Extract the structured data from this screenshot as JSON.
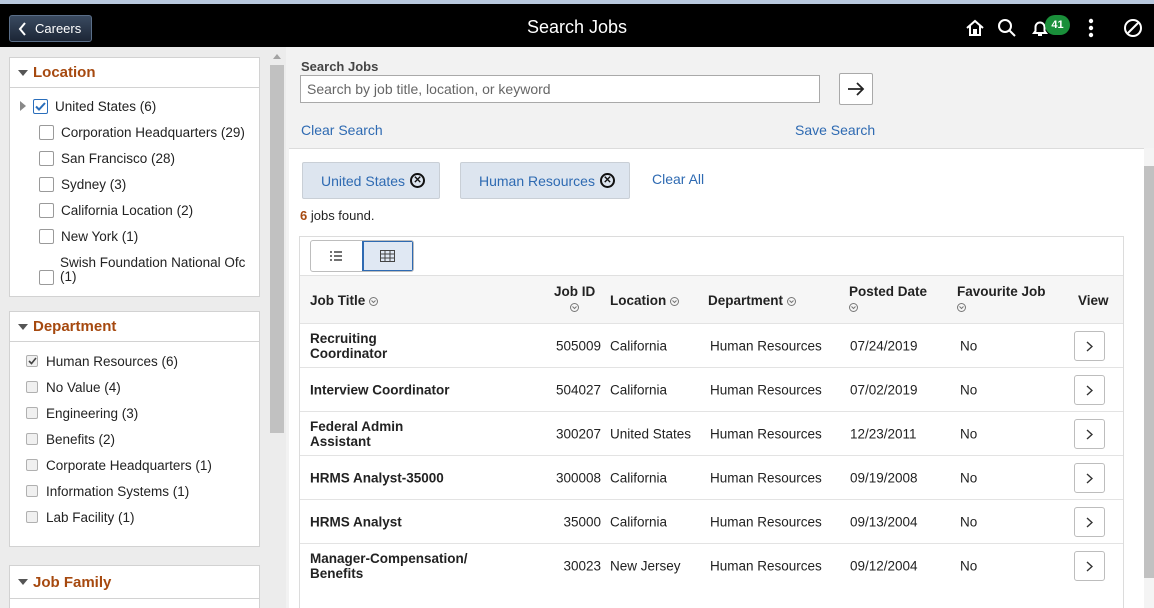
{
  "topbar": {
    "back_label": "Careers",
    "title": "Search Jobs",
    "notification_count": "41",
    "icons": [
      "home-icon",
      "search-icon",
      "bell-icon",
      "more-vertical-icon",
      "compass-icon"
    ]
  },
  "facets": {
    "location": {
      "title": "Location",
      "items": [
        {
          "label": "United States (6)",
          "checked": true
        },
        {
          "label": "Corporation Headquarters (29)",
          "checked": false
        },
        {
          "label": "San Francisco (28)",
          "checked": false
        },
        {
          "label": "Sydney (3)",
          "checked": false
        },
        {
          "label": "California Location (2)",
          "checked": false
        },
        {
          "label": "New York (1)",
          "checked": false
        },
        {
          "label": "Swish Foundation National Ofc",
          "label2": "(1)",
          "checked": false
        }
      ]
    },
    "department": {
      "title": "Department",
      "items": [
        {
          "label": "Human Resources (6)",
          "checked": true
        },
        {
          "label": "No Value (4)",
          "checked": false
        },
        {
          "label": "Engineering (3)",
          "checked": false
        },
        {
          "label": "Benefits (2)",
          "checked": false
        },
        {
          "label": "Corporate Headquarters (1)",
          "checked": false
        },
        {
          "label": "Information Systems (1)",
          "checked": false
        },
        {
          "label": "Lab Facility (1)",
          "checked": false
        }
      ]
    },
    "job_family": {
      "title": "Job Family"
    }
  },
  "search": {
    "label": "Search Jobs",
    "placeholder": "Search by job title, location, or keyword",
    "value": "",
    "clear_label": "Clear Search",
    "save_label": "Save Search"
  },
  "filters": {
    "chips": [
      "United States",
      "Human Resources"
    ],
    "clear_all": "Clear All"
  },
  "results": {
    "count": "6",
    "count_suffix": " jobs found."
  },
  "grid": {
    "columns": {
      "title": "Job Title",
      "jobid": "Job ID",
      "location": "Location",
      "department": "Department",
      "posted": "Posted Date",
      "favourite": "Favourite Job",
      "view": "View"
    },
    "rows": [
      {
        "title": "Recruiting Coordinator",
        "jobid": "505009",
        "location": "California",
        "department": "Human Resources",
        "posted": "07/24/2019",
        "favourite": "No"
      },
      {
        "title": "Interview Coordinator",
        "jobid": "504027",
        "location": "California",
        "department": "Human Resources",
        "posted": "07/02/2019",
        "favourite": "No"
      },
      {
        "title": "Federal Admin Assistant",
        "jobid": "300207",
        "location": "United States",
        "department": "Human Resources",
        "posted": "12/23/2011",
        "favourite": "No"
      },
      {
        "title": "HRMS Analyst-35000",
        "jobid": "300008",
        "location": "California",
        "department": "Human Resources",
        "posted": "09/19/2008",
        "favourite": "No"
      },
      {
        "title": "HRMS Analyst",
        "jobid": "35000",
        "location": "California",
        "department": "Human Resources",
        "posted": "09/13/2004",
        "favourite": "No"
      },
      {
        "title": "Manager-Compensation/Benefits",
        "jobid": "30023",
        "location": "New Jersey",
        "department": "Human Resources",
        "posted": "09/12/2004",
        "favourite": "No"
      }
    ]
  }
}
